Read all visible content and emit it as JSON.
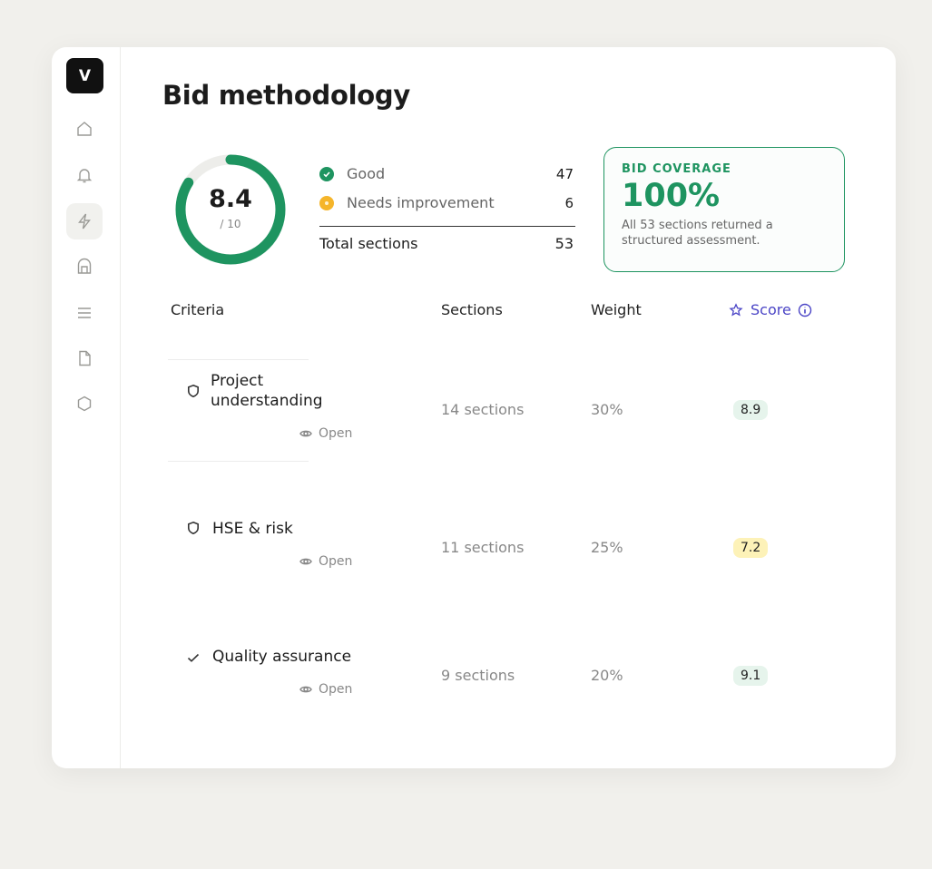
{
  "sidebar": {
    "logo": "V",
    "items": [
      {
        "icon": "home-icon"
      },
      {
        "icon": "bell-icon"
      },
      {
        "icon": "lightning-icon",
        "active": true
      },
      {
        "icon": "archive-icon"
      },
      {
        "icon": "menu-icon"
      },
      {
        "icon": "document-icon"
      },
      {
        "icon": "hexagon-icon"
      }
    ]
  },
  "page": {
    "title": "Bid methodology"
  },
  "gauge": {
    "value": "8.4",
    "max": "/ 10",
    "fraction": 0.84,
    "color": "#1e9460"
  },
  "summary": {
    "good_label": "Good",
    "good_count": "47",
    "needs_label": "Needs improvement",
    "needs_count": "6",
    "total_label": "Total sections",
    "total_count": "53"
  },
  "coverage": {
    "label": "BID COVERAGE",
    "value": "100%",
    "description": "All 53 sections returned a structured assessment."
  },
  "table": {
    "headers": {
      "criteria": "Criteria",
      "sections": "Sections",
      "weight": "Weight",
      "score": "Score"
    },
    "rows": [
      {
        "icon": "shield-icon",
        "label": "Project understanding",
        "sections": "14 sections",
        "weight": "30%",
        "score": "8.9",
        "score_level": "good",
        "open": "Open"
      },
      {
        "icon": "shield-icon",
        "label": "HSE & risk",
        "sections": "11 sections",
        "weight": "25%",
        "score": "7.2",
        "score_level": "warn",
        "open": "Open"
      },
      {
        "icon": "check-icon",
        "label": "Quality assurance",
        "sections": "9 sections",
        "weight": "20%",
        "score": "9.1",
        "score_level": "good",
        "open": "Open"
      }
    ]
  },
  "colors": {
    "accent": "#1e9460",
    "warning": "#f5b52a",
    "score_header": "#4b45c6"
  }
}
